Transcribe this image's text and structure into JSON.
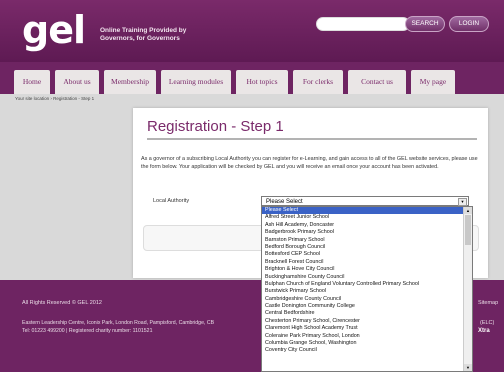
{
  "header": {
    "logo": "gel",
    "tagline_1": "Online Training Provided by",
    "tagline_2": "Governors, for Governors",
    "search_label": "SEARCH",
    "login_label": "LOGIN",
    "search_placeholder": ""
  },
  "nav": {
    "tabs": [
      "Home",
      "About us",
      "Membership",
      "Learning modules",
      "Hot topics",
      "For clerks",
      "Contact us",
      "My page"
    ]
  },
  "breadcrumb": "Your site location › Registration - Step 1",
  "main": {
    "title": "Registration - Step 1",
    "intro": "As a governor of a subscribing Local Authority you can register for e-Learning, and gain access to all of the GEL website services, please use the form below. Your application will be checked by GEL and you will receive an email once your account has been activated.",
    "field_label": "Local Authority",
    "select_value": "Please Select"
  },
  "dropdown": {
    "options": [
      "Please Select",
      "Alfred Street Junior School",
      "Ash Hill Academy, Doncaster",
      "Badgerbrook Primary School",
      "Barnston Primary School",
      "Bedford Borough Council",
      "Bottesford CEP School",
      "Bracknell Forest Council",
      "Brighton & Hove City Council",
      "Buckinghamshire County Council",
      "Bulphan Church of England Voluntary Controlled Primary School",
      "Burstwick Primary School",
      "Cambridgeshire County Council",
      "Castle Donington Community College",
      "Central Bedfordshire",
      "Chesterton Primary School, Cirencester",
      "Claremont High School Academy Trust",
      "Coleraine Park Primary School, London",
      "Columbia Grange School, Washington",
      "Coventry City Council"
    ],
    "selected_index": 0
  },
  "footer": {
    "rights": "All Rights Reserved © GEL 2012",
    "line1": "Eastern Leadership Centre, Iconix Park, London Road, Pampisford, Cambridge, CB",
    "line2": "Tel: 01223 499200 | Registered charity number: 1101521",
    "sitemap": "Sitemap",
    "elc": "(ELC)",
    "xtra": "Xtra"
  }
}
